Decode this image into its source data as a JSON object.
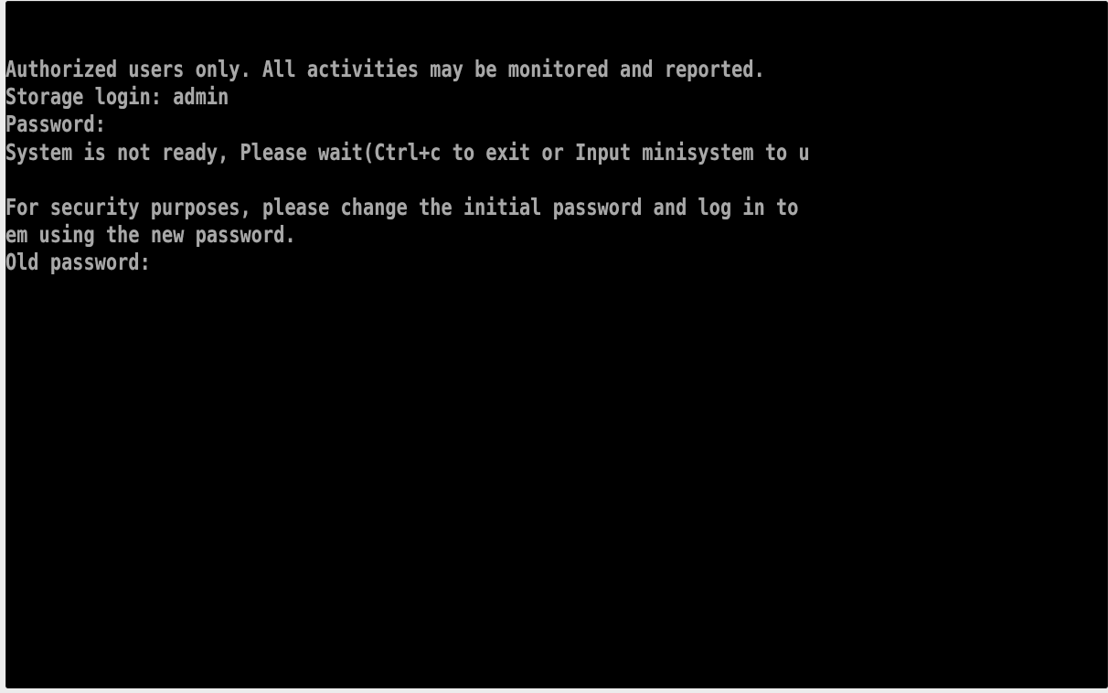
{
  "console": {
    "lines": [
      "Authorized users only. All activities may be monitored and reported.",
      "Storage login: admin",
      "Password:",
      "System is not ready, Please wait(Ctrl+c to exit or Input minisystem to u",
      "",
      "For security purposes, please change the initial password and log in to",
      "em using the new password."
    ],
    "old_password_prompt": "Old password:",
    "old_password_value": ""
  },
  "colors": {
    "background": "#000000",
    "text": "#a8a8a8",
    "frame": "#ececec"
  }
}
